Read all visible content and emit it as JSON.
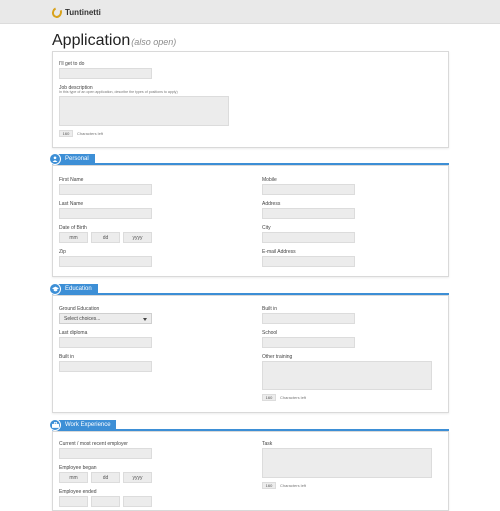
{
  "brand": {
    "name": "Tuntinetti"
  },
  "title": {
    "main": "Application",
    "sub": "(also open)"
  },
  "intro": {
    "todo_label": "I'll get to do",
    "job_label": "Job description",
    "job_hint": "In this type of an open application, describe the types of positions to apply)",
    "counter_value": "160",
    "counter_text": "Characters left"
  },
  "personal": {
    "title": "Personal",
    "first_name": "First Name",
    "last_name": "Last Name",
    "dob": "Date of Birth",
    "mm": "mm",
    "dd": "dd",
    "yyyy": "yyyy",
    "zip": "Zip",
    "mobile": "Mobile",
    "address": "Address",
    "city": "City",
    "email": "E-mail Address"
  },
  "education": {
    "title": "Education",
    "ground": "Ground Education",
    "select_placeholder": "Select choices...",
    "last_diploma": "Last diploma",
    "built_in_left": "Built in",
    "built_in_right": "Built in",
    "school": "School",
    "other_training": "Other training",
    "counter_value": "160",
    "counter_text": "Characters left"
  },
  "work": {
    "title": "Work Experience",
    "employer": "Current / most recent employer",
    "began": "Employee began",
    "ended": "Employee ended",
    "mm": "mm",
    "dd": "dd",
    "yyyy": "yyyy",
    "task": "Task",
    "counter_value": "160",
    "counter_text": "Characters left"
  },
  "colors": {
    "accent": "#3d8fd6",
    "logo": "#d8a21c",
    "field": "#ececec"
  },
  "icons": {
    "personal": "user-icon",
    "education": "graduation-cap-icon",
    "work": "briefcase-icon"
  }
}
